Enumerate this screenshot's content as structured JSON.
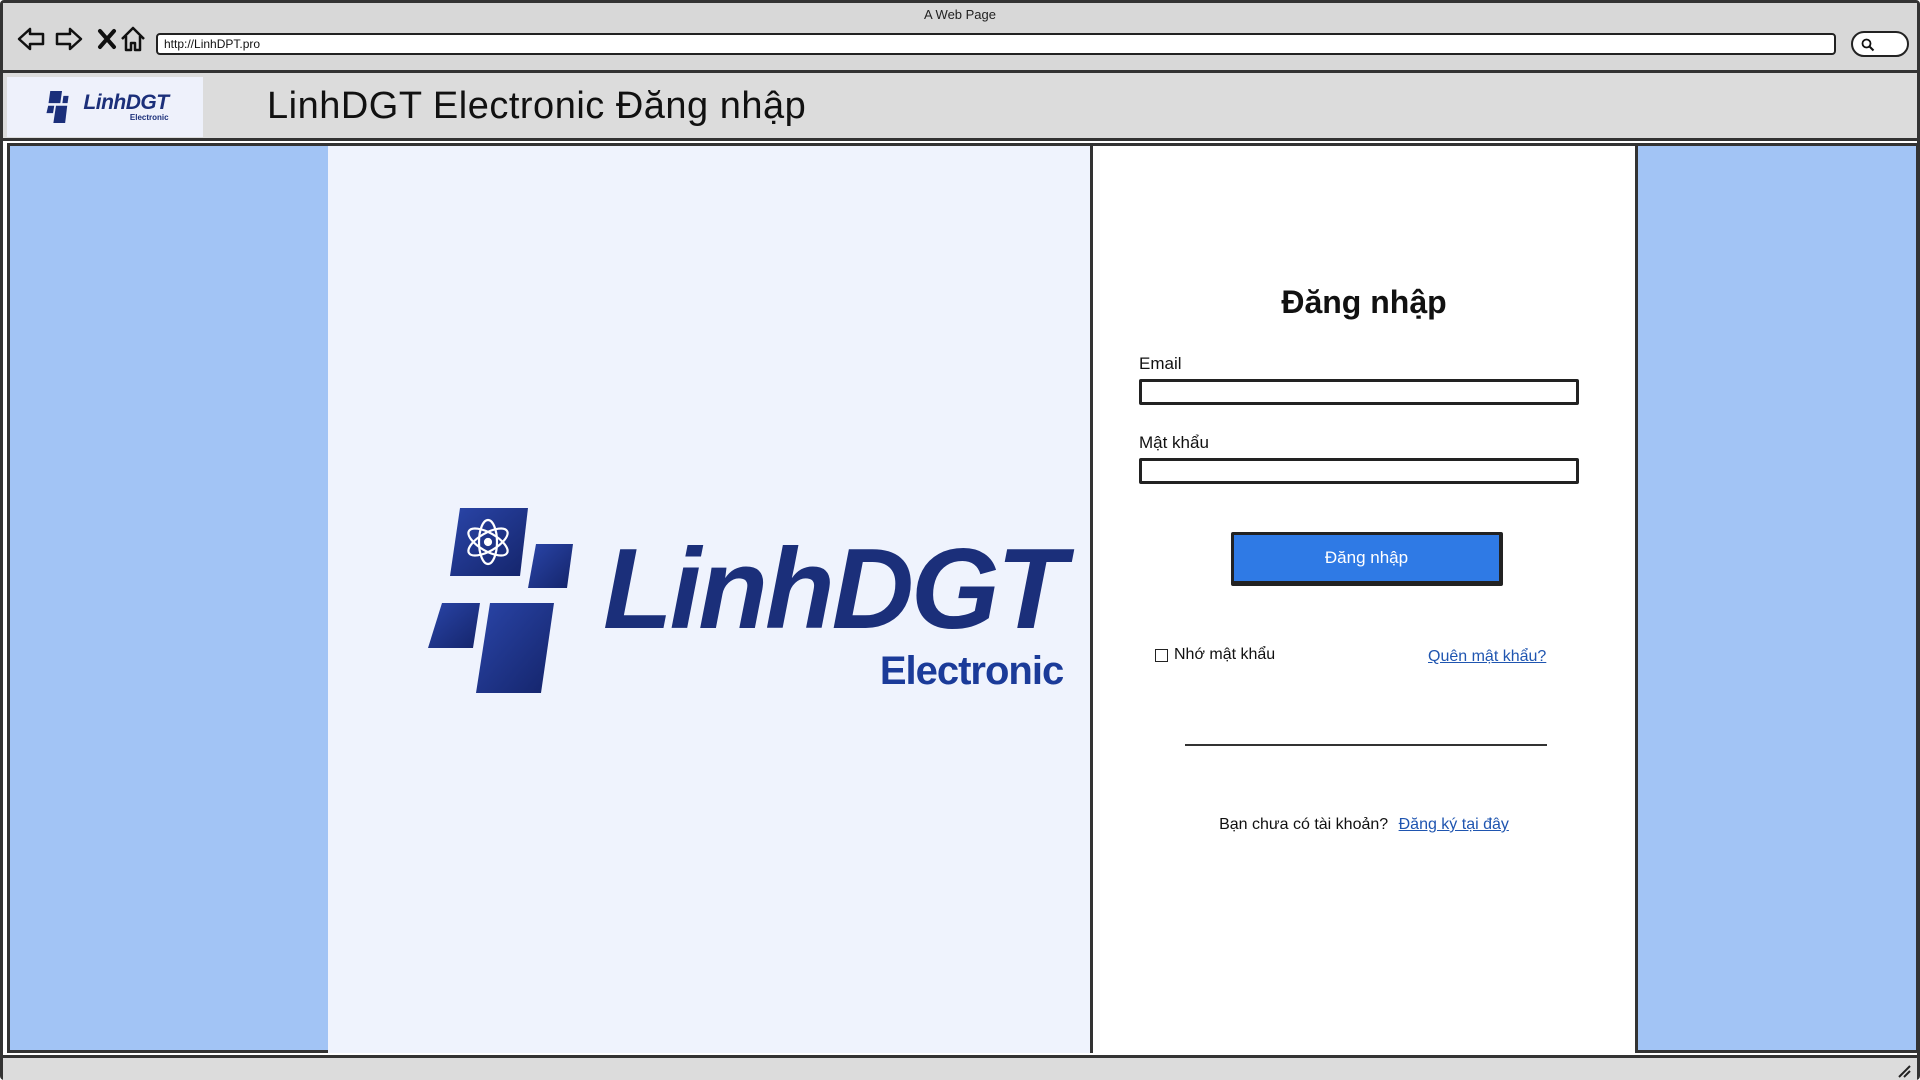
{
  "window": {
    "title": "A Web Page",
    "address": "http://LinhDPT.pro"
  },
  "nav": {
    "back_icon": "back-arrow-icon",
    "forward_icon": "forward-arrow-icon",
    "close_icon": "close-x-icon",
    "home_icon": "home-icon",
    "search_icon": "search-icon"
  },
  "header": {
    "logo_brand": "LinhDGT",
    "logo_sub": "Electronic",
    "title": "LinhDGT Electronic Đăng nhập"
  },
  "hero": {
    "brand": "LinhDGT",
    "sub": "Electronic"
  },
  "login": {
    "heading": "Đăng nhập",
    "email_label": "Email",
    "email_value": "",
    "password_label": "Mật khẩu",
    "password_value": "",
    "submit_label": "Đăng nhập",
    "remember_label": "Nhớ mật khẩu",
    "forgot_label": "Quên mật khẩu?",
    "signup_prompt": "Bạn chưa có tài khoản?",
    "signup_link": "Đăng ký tại đây"
  },
  "colors": {
    "brand_navy": "#1b2f7a",
    "background_blue": "#a2c4f5",
    "hero_bg": "#eff3fd",
    "button_blue": "#2f7ae5",
    "link_blue": "#1f55b0"
  }
}
